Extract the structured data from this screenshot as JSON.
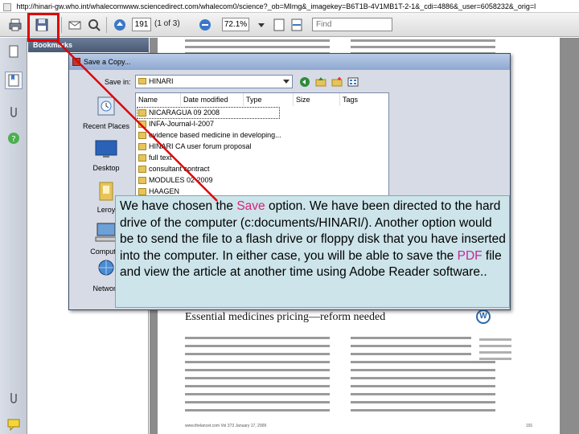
{
  "browser": {
    "url": "http://hinari-gw.who.int/whalecomwww.sciencedirect.com/whalecom0/science?_ob=MImg&_imagekey=B6T1B-4V1MB1T-2-1&_cdi=4886&_user=6058232&_orig=l"
  },
  "pdf_toolbar": {
    "page_number": "191",
    "page_of": "(1 of 3)",
    "zoom": "72.1%",
    "find_placeholder": "Find"
  },
  "bookmarks": {
    "header": "Bookmarks"
  },
  "document": {
    "article_title": "Essential medicines pricing—reform needed",
    "footer_left": "www.thelancet.com Vol 373 January 17, 2009",
    "footer_right": "191"
  },
  "dialog": {
    "title": "Save a Copy...",
    "save_in_label": "Save in:",
    "save_in_value": "HINARI",
    "columns": [
      "Name",
      "Date modified",
      "Type",
      "Size",
      "Tags"
    ],
    "places": [
      "Recent Places",
      "Desktop",
      "Leroy",
      "Computer",
      "Network"
    ],
    "files": [
      {
        "name": "NICARAGUA 09 2008",
        "kind": "folder"
      },
      {
        "name": "INFA-Journal-I-2007",
        "kind": "folder"
      },
      {
        "name": "evidence based medicine in developing...",
        "kind": "folder"
      },
      {
        "name": "HINARI CA user forum proposal",
        "kind": "folder"
      },
      {
        "name": "full text",
        "kind": "folder"
      },
      {
        "name": "consultant contract",
        "kind": "folder"
      },
      {
        "name": "MODULES 02 2009",
        "kind": "folder"
      },
      {
        "name": "HAAGEN",
        "kind": "folder"
      }
    ]
  },
  "callout": {
    "part1": "We have chosen the ",
    "save_word": "Save",
    "part2": " option.  We have been directed to the hard drive of the computer (c:documents/HINARI/).  Another option would be to send the file to a flash drive or floppy disk that you have inserted into the computer.  In either case, you will be able to save the ",
    "pdf_word": "PDF",
    "part3": " file and view the article at another time using Adobe Reader software.."
  },
  "colors": {
    "annotation_red": "#e00000",
    "callout_bg": "#cce4ea",
    "save_highlight": "#d6257a",
    "pdf_highlight": "#c32899"
  }
}
